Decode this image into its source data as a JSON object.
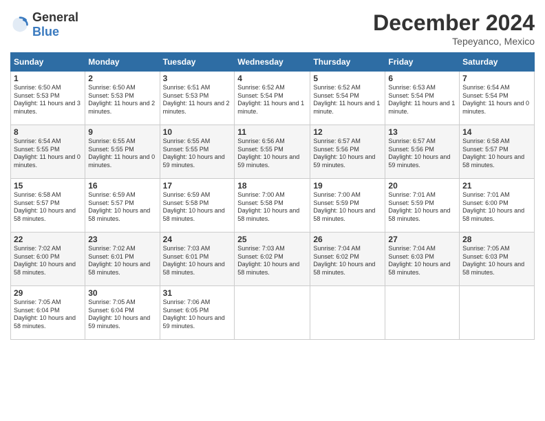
{
  "logo": {
    "general": "General",
    "blue": "Blue"
  },
  "header": {
    "month": "December 2024",
    "location": "Tepeyanco, Mexico"
  },
  "weekdays": [
    "Sunday",
    "Monday",
    "Tuesday",
    "Wednesday",
    "Thursday",
    "Friday",
    "Saturday"
  ],
  "weeks": [
    [
      {
        "day": "1",
        "sunrise": "6:50 AM",
        "sunset": "5:53 PM",
        "daylight": "11 hours and 3 minutes."
      },
      {
        "day": "2",
        "sunrise": "6:50 AM",
        "sunset": "5:53 PM",
        "daylight": "11 hours and 2 minutes."
      },
      {
        "day": "3",
        "sunrise": "6:51 AM",
        "sunset": "5:53 PM",
        "daylight": "11 hours and 2 minutes."
      },
      {
        "day": "4",
        "sunrise": "6:52 AM",
        "sunset": "5:54 PM",
        "daylight": "11 hours and 1 minute."
      },
      {
        "day": "5",
        "sunrise": "6:52 AM",
        "sunset": "5:54 PM",
        "daylight": "11 hours and 1 minute."
      },
      {
        "day": "6",
        "sunrise": "6:53 AM",
        "sunset": "5:54 PM",
        "daylight": "11 hours and 1 minute."
      },
      {
        "day": "7",
        "sunrise": "6:54 AM",
        "sunset": "5:54 PM",
        "daylight": "11 hours and 0 minutes."
      }
    ],
    [
      {
        "day": "8",
        "sunrise": "6:54 AM",
        "sunset": "5:55 PM",
        "daylight": "11 hours and 0 minutes."
      },
      {
        "day": "9",
        "sunrise": "6:55 AM",
        "sunset": "5:55 PM",
        "daylight": "11 hours and 0 minutes."
      },
      {
        "day": "10",
        "sunrise": "6:55 AM",
        "sunset": "5:55 PM",
        "daylight": "10 hours and 59 minutes."
      },
      {
        "day": "11",
        "sunrise": "6:56 AM",
        "sunset": "5:55 PM",
        "daylight": "10 hours and 59 minutes."
      },
      {
        "day": "12",
        "sunrise": "6:57 AM",
        "sunset": "5:56 PM",
        "daylight": "10 hours and 59 minutes."
      },
      {
        "day": "13",
        "sunrise": "6:57 AM",
        "sunset": "5:56 PM",
        "daylight": "10 hours and 59 minutes."
      },
      {
        "day": "14",
        "sunrise": "6:58 AM",
        "sunset": "5:57 PM",
        "daylight": "10 hours and 58 minutes."
      }
    ],
    [
      {
        "day": "15",
        "sunrise": "6:58 AM",
        "sunset": "5:57 PM",
        "daylight": "10 hours and 58 minutes."
      },
      {
        "day": "16",
        "sunrise": "6:59 AM",
        "sunset": "5:57 PM",
        "daylight": "10 hours and 58 minutes."
      },
      {
        "day": "17",
        "sunrise": "6:59 AM",
        "sunset": "5:58 PM",
        "daylight": "10 hours and 58 minutes."
      },
      {
        "day": "18",
        "sunrise": "7:00 AM",
        "sunset": "5:58 PM",
        "daylight": "10 hours and 58 minutes."
      },
      {
        "day": "19",
        "sunrise": "7:00 AM",
        "sunset": "5:59 PM",
        "daylight": "10 hours and 58 minutes."
      },
      {
        "day": "20",
        "sunrise": "7:01 AM",
        "sunset": "5:59 PM",
        "daylight": "10 hours and 58 minutes."
      },
      {
        "day": "21",
        "sunrise": "7:01 AM",
        "sunset": "6:00 PM",
        "daylight": "10 hours and 58 minutes."
      }
    ],
    [
      {
        "day": "22",
        "sunrise": "7:02 AM",
        "sunset": "6:00 PM",
        "daylight": "10 hours and 58 minutes."
      },
      {
        "day": "23",
        "sunrise": "7:02 AM",
        "sunset": "6:01 PM",
        "daylight": "10 hours and 58 minutes."
      },
      {
        "day": "24",
        "sunrise": "7:03 AM",
        "sunset": "6:01 PM",
        "daylight": "10 hours and 58 minutes."
      },
      {
        "day": "25",
        "sunrise": "7:03 AM",
        "sunset": "6:02 PM",
        "daylight": "10 hours and 58 minutes."
      },
      {
        "day": "26",
        "sunrise": "7:04 AM",
        "sunset": "6:02 PM",
        "daylight": "10 hours and 58 minutes."
      },
      {
        "day": "27",
        "sunrise": "7:04 AM",
        "sunset": "6:03 PM",
        "daylight": "10 hours and 58 minutes."
      },
      {
        "day": "28",
        "sunrise": "7:05 AM",
        "sunset": "6:03 PM",
        "daylight": "10 hours and 58 minutes."
      }
    ],
    [
      {
        "day": "29",
        "sunrise": "7:05 AM",
        "sunset": "6:04 PM",
        "daylight": "10 hours and 58 minutes."
      },
      {
        "day": "30",
        "sunrise": "7:05 AM",
        "sunset": "6:04 PM",
        "daylight": "10 hours and 59 minutes."
      },
      {
        "day": "31",
        "sunrise": "7:06 AM",
        "sunset": "6:05 PM",
        "daylight": "10 hours and 59 minutes."
      },
      null,
      null,
      null,
      null
    ]
  ],
  "labels": {
    "sunrise": "Sunrise:",
    "sunset": "Sunset:",
    "daylight": "Daylight:"
  }
}
